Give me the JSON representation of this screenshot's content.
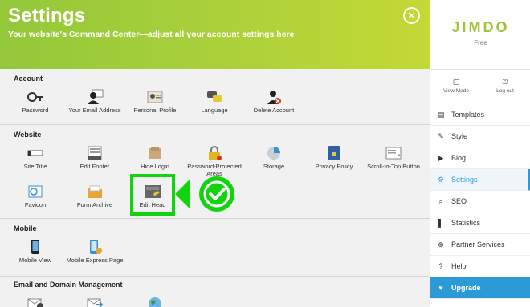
{
  "header": {
    "title": "Settings",
    "subtitle": "Your website's Command Center—adjust all your account settings here",
    "close_icon": "✕"
  },
  "sections": {
    "account": {
      "title": "Account",
      "items": [
        {
          "label": "Password"
        },
        {
          "label": "Your Email Address"
        },
        {
          "label": "Personal Profile"
        },
        {
          "label": "Language"
        },
        {
          "label": "Delete Account"
        }
      ]
    },
    "website": {
      "title": "Website",
      "items": [
        {
          "label": "Site Title"
        },
        {
          "label": "Edit Footer"
        },
        {
          "label": "Hide Login"
        },
        {
          "label": "Password-Protected Areas"
        },
        {
          "label": "Storage"
        },
        {
          "label": "Privacy Policy"
        },
        {
          "label": "Scroll-to-Top Button"
        },
        {
          "label": "Favicon"
        },
        {
          "label": "Form Archive"
        },
        {
          "label": "Edit Head"
        }
      ]
    },
    "mobile": {
      "title": "Mobile",
      "items": [
        {
          "label": "Mobile View"
        },
        {
          "label": "Mobile Express Page"
        }
      ]
    },
    "email": {
      "title": "Email and Domain Management"
    }
  },
  "sidebar": {
    "logo": "JIMDO",
    "plan": "Free",
    "view_mode": "View Mode",
    "log_out": "Log out",
    "nav": [
      {
        "label": "Templates",
        "icon": "▤"
      },
      {
        "label": "Style",
        "icon": "✎"
      },
      {
        "label": "Blog",
        "icon": "▶"
      },
      {
        "label": "Settings",
        "icon": "⚙"
      },
      {
        "label": "SEO",
        "icon": "⌕"
      },
      {
        "label": "Statistics",
        "icon": "▌"
      },
      {
        "label": "Partner Services",
        "icon": "⊕"
      },
      {
        "label": "Help",
        "icon": "?"
      }
    ],
    "upgrade": {
      "label": "Upgrade",
      "icon": "♥"
    },
    "active_color": "#2b9ad6"
  },
  "colors": {
    "header_green": "#9fc63a",
    "highlight_green": "#12d40e",
    "accent_blue": "#2b9ad6"
  }
}
